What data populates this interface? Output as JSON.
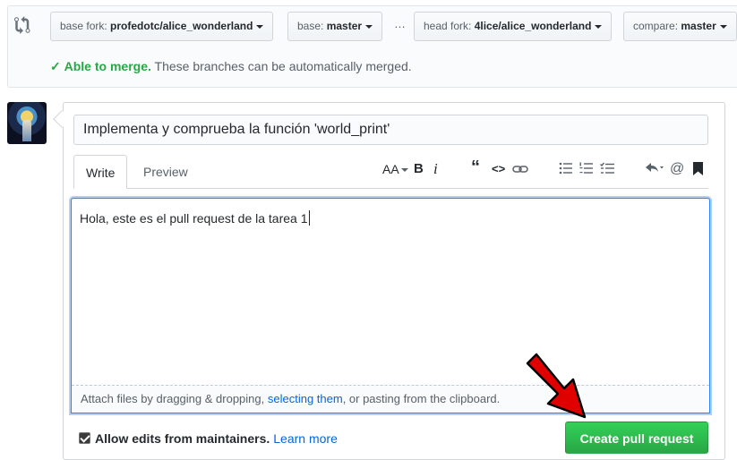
{
  "compare": {
    "icon": "git-compare-icon",
    "base_fork": {
      "prefix": "base fork:",
      "value": "profedotc/alice_wonderland"
    },
    "base": {
      "prefix": "base:",
      "value": "master"
    },
    "ellipsis": "…",
    "head_fork": {
      "prefix": "head fork:",
      "value": "4lice/alice_wonderland"
    },
    "compare_branch": {
      "prefix": "compare:",
      "value": "master"
    },
    "merge_status": {
      "strong": "Able to merge.",
      "text": "These branches can be automatically merged."
    }
  },
  "pr_form": {
    "title_value": "Implementa y comprueba la función 'world_print'",
    "tabs": [
      {
        "label": "Write",
        "active": true
      },
      {
        "label": "Preview",
        "active": false
      }
    ],
    "toolbar": {
      "text_size": "AA",
      "bold": "B",
      "italic": "i",
      "quote": "“",
      "code": "<>",
      "link": "link-icon",
      "unordered_list": "unordered-list-icon",
      "ordered_list": "ordered-list-icon",
      "task_list": "task-list-icon",
      "reply": "reply-icon",
      "mention": "@",
      "saved_reply": "bookmark-icon"
    },
    "body_value": "Hola, este es el pull request de la tarea 1",
    "attach": {
      "before": "Attach files by dragging & dropping, ",
      "link": "selecting them",
      "after": ", or pasting from the clipboard."
    },
    "allow_edits": {
      "checked": true,
      "label": "Allow edits from maintainers.",
      "link": "Learn more"
    },
    "submit_label": "Create pull request"
  },
  "colors": {
    "merge_green": "#28a745",
    "button_green": "#2ea44f",
    "link_blue": "#0366d6",
    "annotation_red": "#e00000"
  }
}
